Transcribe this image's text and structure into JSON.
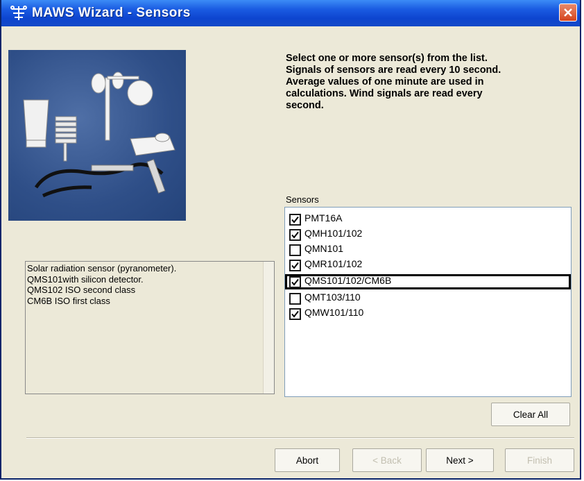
{
  "window": {
    "title": "MAWS Wizard - Sensors"
  },
  "info": {
    "lines": [
      "Select one or more sensor(s) from the list.",
      "Signals of sensors are read every 10 second.",
      "Average values of one minute are used in",
      "calculations. Wind signals are read every",
      "second."
    ]
  },
  "sensors": {
    "label": "Sensors",
    "items": [
      {
        "label": "PMT16A",
        "checked": true
      },
      {
        "label": "QMH101/102",
        "checked": true
      },
      {
        "label": "QMN101",
        "checked": false
      },
      {
        "label": "QMR101/102",
        "checked": true
      },
      {
        "label": "QMS101/102/CM6B",
        "checked": true,
        "focused": true
      },
      {
        "label": "QMT103/110",
        "checked": false
      },
      {
        "label": "QMW101/110",
        "checked": true
      }
    ]
  },
  "description": {
    "text": "Solar radiation sensor (pyranometer).\nQMS101with silicon detector.\nQMS102 ISO second class\nCM6B ISO first class"
  },
  "buttons": {
    "clear_all": "Clear All",
    "abort": "Abort",
    "back": "< Back",
    "next": "Next >",
    "finish": "Finish"
  },
  "icons": {
    "title_icon": "sensor-app-icon",
    "close": "close-icon"
  }
}
